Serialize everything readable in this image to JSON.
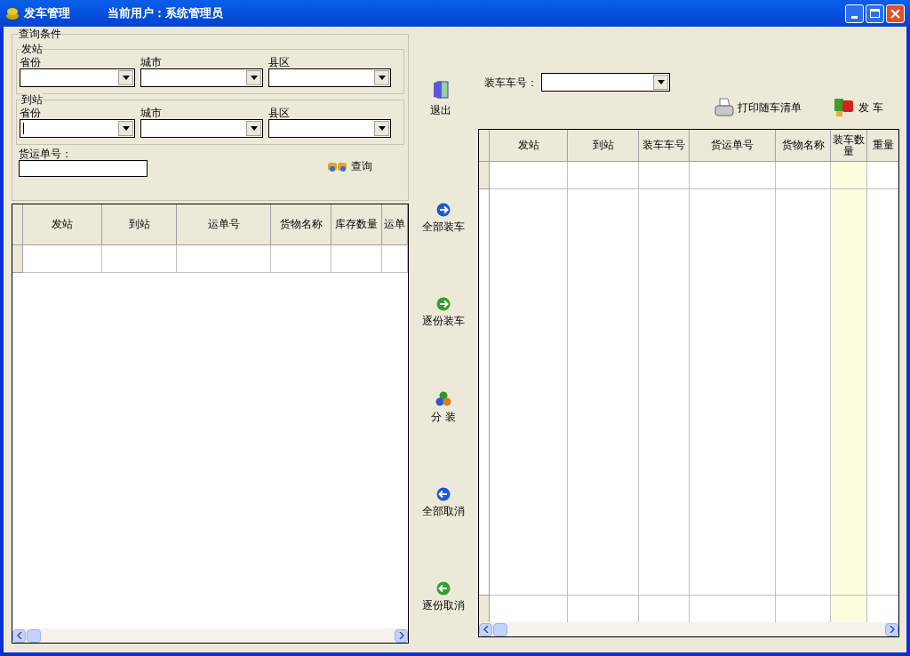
{
  "window": {
    "title": "发车管理",
    "user_label": "当前用户：系统管理员"
  },
  "query": {
    "title": "查询条件",
    "groups": [
      {
        "title": "发站",
        "fields": [
          {
            "label": "省份",
            "focused": false
          },
          {
            "label": "城市",
            "focused": false
          },
          {
            "label": "县区",
            "focused": false
          }
        ]
      },
      {
        "title": "到站",
        "fields": [
          {
            "label": "省份",
            "focused": true
          },
          {
            "label": "城市",
            "focused": false
          },
          {
            "label": "县区",
            "focused": false
          }
        ]
      }
    ],
    "waybill_label": "货运单号：",
    "search_button": "查询"
  },
  "left_table": {
    "columns": [
      {
        "label": "发站",
        "highlighted": false
      },
      {
        "label": "到站",
        "highlighted": false
      },
      {
        "label": "运单号",
        "highlighted": false
      },
      {
        "label": "货物名称",
        "highlighted": false
      },
      {
        "label": "库存数量",
        "highlighted": false
      },
      {
        "label": "运单",
        "highlighted": false
      }
    ]
  },
  "exit_button": "退出",
  "actions": [
    {
      "label": "全部装车",
      "kind": "forward"
    },
    {
      "label": "逐份装车",
      "kind": "step"
    },
    {
      "label": "分 装",
      "kind": "split"
    },
    {
      "label": "全部取消",
      "kind": "back"
    },
    {
      "label": "逐份取消",
      "kind": "unstep"
    }
  ],
  "car_number_label": "装车车号：",
  "print_button": "打印随车清单",
  "depart_button": "发 车",
  "right_table": {
    "columns": [
      {
        "label": "发站",
        "highlighted": false
      },
      {
        "label": "到站",
        "highlighted": false
      },
      {
        "label": "装车车号",
        "highlighted": false
      },
      {
        "label": "货运单号",
        "highlighted": false
      },
      {
        "label": "货物名称",
        "highlighted": false
      },
      {
        "label": "装车数量",
        "highlighted": true
      },
      {
        "label": "重量",
        "highlighted": false
      }
    ]
  }
}
